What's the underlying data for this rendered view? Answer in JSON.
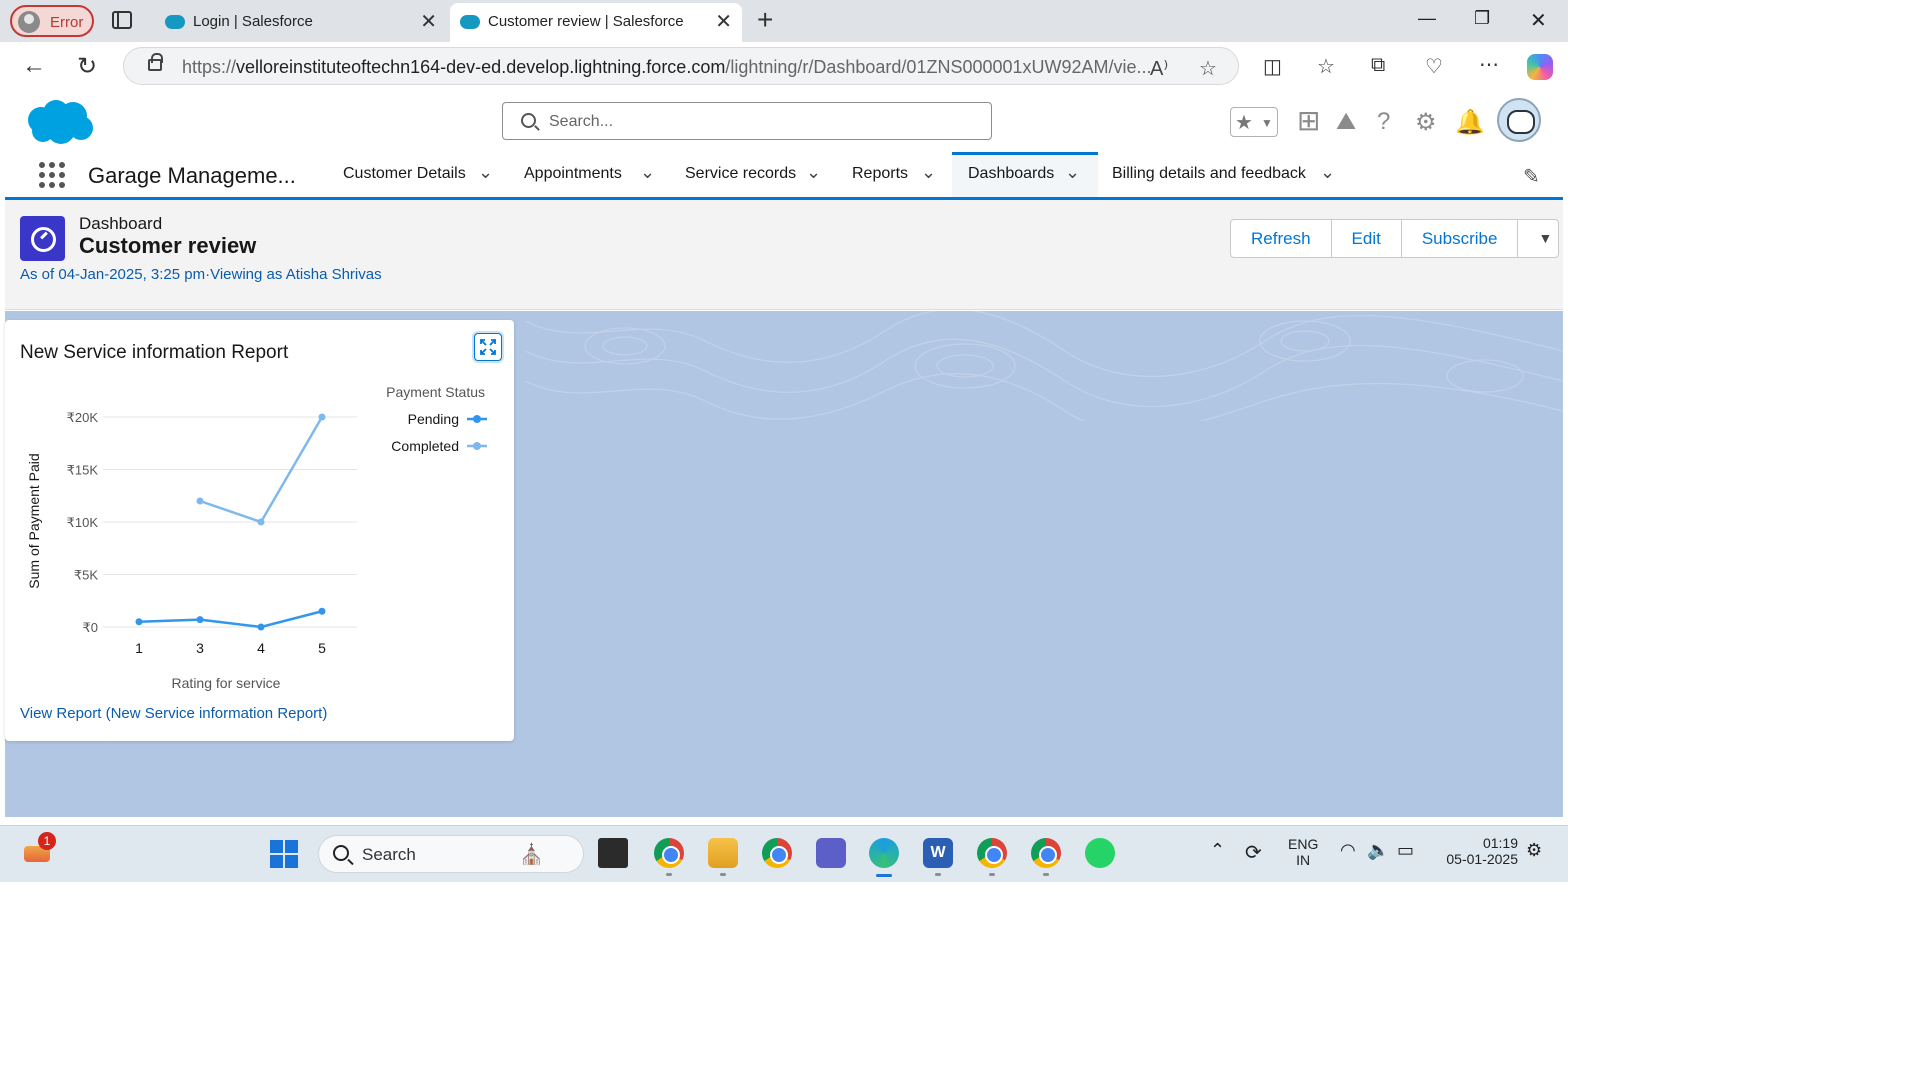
{
  "browser": {
    "profile_label": "Error",
    "tabs": [
      {
        "title": "Login | Salesforce"
      },
      {
        "title": "Customer review | Salesforce"
      }
    ],
    "url_prefix": "https://",
    "url_host": "velloreinstituteoftechn164-dev-ed.develop.lightning.force.com",
    "url_path": "/lightning/r/Dashboard/01ZNS000001xUW92AM/vie..."
  },
  "sf": {
    "search_placeholder": "Search...",
    "app_name": "Garage Manageme...",
    "nav": [
      {
        "label": "Customer Details"
      },
      {
        "label": "Appointments"
      },
      {
        "label": "Service records"
      },
      {
        "label": "Reports"
      },
      {
        "label": "Dashboards"
      },
      {
        "label": "Billing details and feedback"
      }
    ]
  },
  "dashboard": {
    "type_label": "Dashboard",
    "title": "Customer review",
    "meta": "As of 04-Jan-2025, 3:25 pm·Viewing as Atisha Shrivas",
    "buttons": {
      "refresh": "Refresh",
      "edit": "Edit",
      "subscribe": "Subscribe"
    }
  },
  "widget": {
    "title": "New Service information Report",
    "view_report": "View Report (New Service information Report)"
  },
  "chart_data": {
    "type": "line",
    "xlabel": "Rating for service",
    "ylabel": "Sum of Payment Paid",
    "legend_title": "Payment Status",
    "legend_position": "top-right",
    "categories": [
      "1",
      "3",
      "4",
      "5"
    ],
    "y_ticks": [
      "₹0",
      "₹5K",
      "₹10K",
      "₹15K",
      "₹20K"
    ],
    "ylim": [
      0,
      20000
    ],
    "grid": true,
    "series": [
      {
        "name": "Pending",
        "color": "#3296ed",
        "values": [
          500,
          700,
          0,
          1500
        ]
      },
      {
        "name": "Completed",
        "color": "#7fb8ec",
        "values": [
          null,
          12000,
          10000,
          20000
        ]
      }
    ]
  },
  "taskbar": {
    "search_label": "Search",
    "notification_badge": "1",
    "lang_line1": "ENG",
    "lang_line2": "IN",
    "time": "01:19",
    "date": "05-01-2025"
  }
}
